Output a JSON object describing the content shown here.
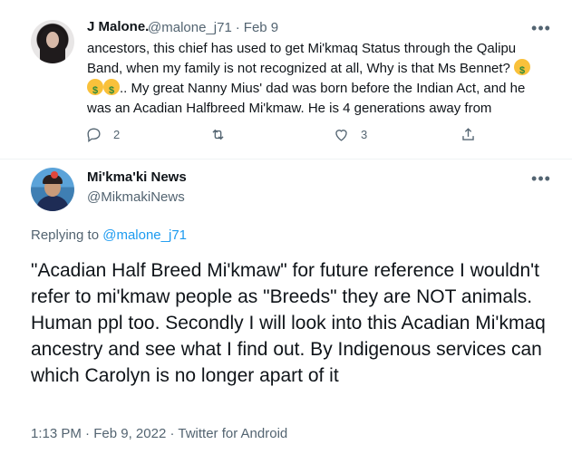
{
  "reply_tweet": {
    "author_name": "J Malone.",
    "handle": "@malone_j71",
    "separator": "·",
    "date": "Feb 9",
    "text_part1": "ancestors, this chief has used to get Mi'kmaq Status through the Qalipu Band, when my family is not recognized at all, Why is that Ms Bennet? ",
    "text_part2": ".. My great Nanny Mius' dad was born before the Indian Act, and he was an Acadian Halfbreed Mi'kmaw. He is 4 generations away from",
    "emoji": "money-mouth-face-icon",
    "reply_count": "2",
    "retweet_count": "",
    "like_count": "3"
  },
  "main_tweet": {
    "author_name": "Mi'kma'ki News",
    "handle": "@MikmakiNews",
    "replying_label": "Replying to",
    "replying_to": "@malone_j71",
    "text": "\"Acadian Half Breed Mi'kmaw\" for future reference I wouldn't refer to mi'kmaw people as \"Breeds\" they are NOT animals. Human ppl too. Secondly I will look into this Acadian Mi'kmaq ancestry and see what I find out. By Indigenous services can which Carolyn is no longer apart of it",
    "time": "1:13 PM",
    "date": "Feb 9, 2022",
    "source": "Twitter for Android",
    "separator": "·"
  },
  "more_label": "•••",
  "colors": {
    "text": "#0f1419",
    "secondary": "#536471",
    "link": "#1d9bf0",
    "divider": "#eff3f4"
  }
}
